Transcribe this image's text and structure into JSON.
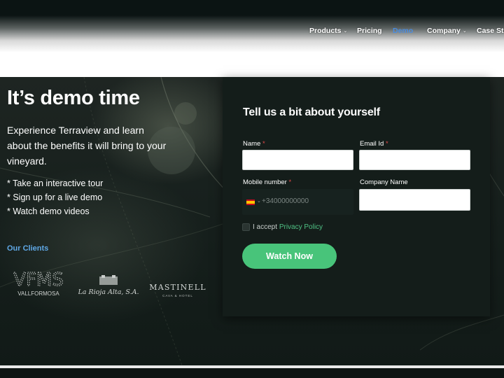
{
  "nav": {
    "items": [
      {
        "label": "Products",
        "has_dropdown": true
      },
      {
        "label": "Pricing",
        "has_dropdown": false
      },
      {
        "label": "Demo",
        "has_dropdown": false,
        "active": true
      },
      {
        "label": "Company",
        "has_dropdown": true
      },
      {
        "label": "Case Stu",
        "has_dropdown": false
      }
    ],
    "dropdown_glyph": "⌄"
  },
  "hero": {
    "title": "It’s demo time",
    "description": "Experience Terraview and learn about the benefits it will bring to your vineyard.",
    "bullets": [
      "* Take an interactive tour",
      "* Sign up for a live demo",
      "* Watch demo videos"
    ],
    "clients_label": "Our Clients",
    "client_logos": [
      {
        "name": "VFMS",
        "subtitle": "VALLFORMOSA"
      },
      {
        "name": "La Rioja Alta, S.A."
      },
      {
        "name": "MASTINELL",
        "subtitle": "CAVA & HOTEL"
      }
    ]
  },
  "form": {
    "title": "Tell us a bit about yourself",
    "required_marker": "*",
    "name_label": "Name",
    "email_label": "Email Id",
    "mobile_label": "Mobile number",
    "company_label": "Company Name",
    "name_value": "",
    "email_value": "",
    "company_value": "",
    "phone_placeholder": "+34000000000",
    "phone_country": "ES",
    "accept_prefix": "I accept",
    "privacy_link": "Privacy Policy",
    "submit_label": "Watch Now"
  },
  "colors": {
    "accent_green": "#48c47a",
    "nav_active": "#4a8de0",
    "clients_label": "#5fa8e6",
    "required": "#e04848",
    "background": "#0f1a18"
  }
}
